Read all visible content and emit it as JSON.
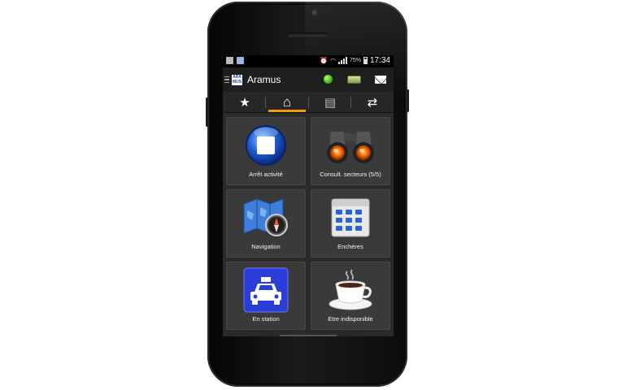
{
  "status_bar": {
    "battery_percent": "75%",
    "time": "17:34",
    "icons": [
      "image-icon",
      "notification-icon",
      "alarm-icon",
      "wifi-icon",
      "signal-icon",
      "battery-icon"
    ]
  },
  "app_bar": {
    "title": "Aramus",
    "logo_text": "ARA MUS",
    "icons": [
      "menu-icon",
      "status-online-icon",
      "taxi-sign-icon",
      "mail-icon"
    ]
  },
  "tabs": [
    {
      "icon": "star-icon",
      "glyph": "★",
      "active": false
    },
    {
      "icon": "home-icon",
      "glyph": "⌂",
      "active": true
    },
    {
      "icon": "document-icon",
      "glyph": "▤",
      "active": false
    },
    {
      "icon": "swap-icon",
      "glyph": "⇄",
      "active": false
    }
  ],
  "tiles": [
    {
      "label": "Arrêt activité",
      "icon": "stop-button-icon"
    },
    {
      "label": "Consult. secteurs (5/5)",
      "icon": "binoculars-icon"
    },
    {
      "label": "Navigation",
      "icon": "map-compass-icon"
    },
    {
      "label": "Enchères",
      "icon": "calendar-grid-icon"
    },
    {
      "label": "En station",
      "icon": "taxi-icon"
    },
    {
      "label": "Etre indisponible",
      "icon": "coffee-cup-icon"
    }
  ],
  "colors": {
    "accent": "#f0a000",
    "screen_bg": "#2a2a2a",
    "tile_bg": "#3a3a3a",
    "online": "#3eb51b",
    "taxi_blue": "#2a3dd8"
  }
}
